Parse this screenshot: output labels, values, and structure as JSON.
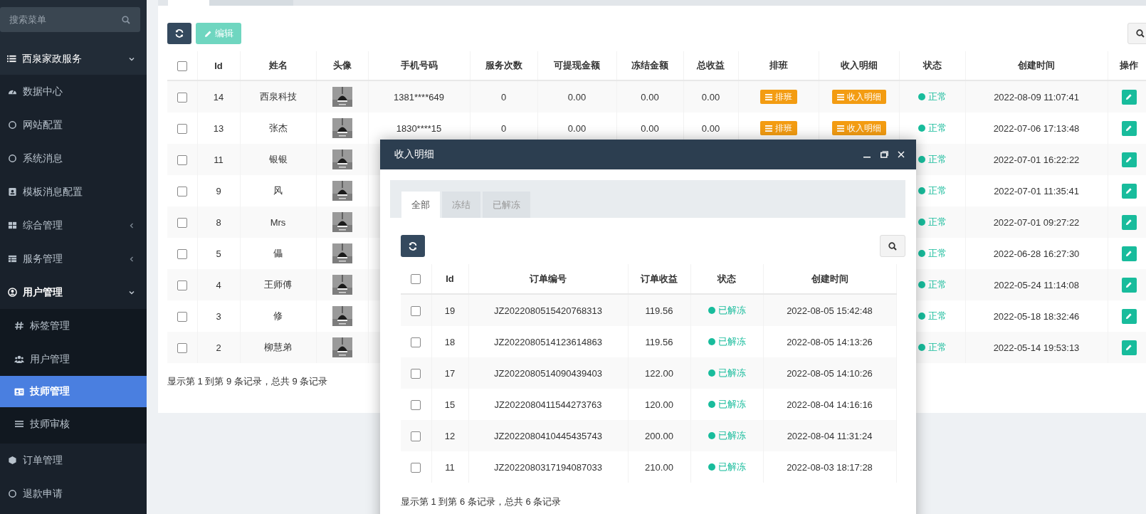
{
  "sidebar": {
    "search": {
      "placeholder": "搜索菜单"
    },
    "items": [
      {
        "label": "西泉家政服务",
        "kind": "group",
        "expanded": true
      },
      {
        "label": "数据中心",
        "kind": "item",
        "selected": false
      },
      {
        "label": "网站配置",
        "kind": "item",
        "selected": false
      },
      {
        "label": "系统消息",
        "kind": "item",
        "selected": false
      },
      {
        "label": "模板消息配置",
        "kind": "item",
        "selected": false
      },
      {
        "label": "综合管理",
        "kind": "item",
        "selected": false,
        "expanded": false
      },
      {
        "label": "服务管理",
        "kind": "item",
        "selected": false,
        "expanded": false
      },
      {
        "label": "用户管理",
        "kind": "item",
        "selected": false,
        "expanded": true,
        "children": [
          {
            "label": "标签管理",
            "selected": false
          },
          {
            "label": "用户管理",
            "selected": false
          },
          {
            "label": "技师管理",
            "selected": true
          },
          {
            "label": "技师审核",
            "selected": false
          }
        ]
      },
      {
        "label": "订单管理",
        "kind": "item",
        "selected": false
      },
      {
        "label": "退款申请",
        "kind": "item",
        "selected": false
      }
    ]
  },
  "toolbar": {
    "edit_label": "编辑"
  },
  "table": {
    "header_checked": false,
    "columns": [
      "Id",
      "姓名",
      "头像",
      "手机号码",
      "服务次数",
      "可提现金额",
      "冻结金额",
      "总收益",
      "排班",
      "收入明细",
      "状态",
      "创建时间",
      "操作"
    ],
    "rows": [
      {
        "checked": false,
        "id": "14",
        "name": "西泉科技",
        "phone": "1381****649",
        "service_count": "0",
        "withdrawable": "0.00",
        "frozen": "0.00",
        "total": "0.00",
        "schedule": "排班",
        "income": "收入明细",
        "status": "正常",
        "created": "2022-08-09 11:07:41"
      },
      {
        "checked": false,
        "id": "13",
        "name": "张杰",
        "phone": "1830****15",
        "service_count": "0",
        "withdrawable": "0.00",
        "frozen": "0.00",
        "total": "0.00",
        "schedule": "排班",
        "income": "收入明细",
        "status": "正常",
        "created": "2022-07-06 17:13:48"
      },
      {
        "checked": false,
        "id": "11",
        "name": "银银",
        "status": "正常",
        "created": "2022-07-01 16:22:22"
      },
      {
        "checked": false,
        "id": "9",
        "name": "风",
        "status": "正常",
        "created": "2022-07-01 11:35:41"
      },
      {
        "checked": false,
        "id": "8",
        "name": "Mrs",
        "status": "正常",
        "created": "2022-07-01 09:27:22"
      },
      {
        "checked": false,
        "id": "5",
        "name": "儡",
        "status": "正常",
        "created": "2022-06-28 16:27:30"
      },
      {
        "checked": false,
        "id": "4",
        "name": "王师傅",
        "status": "正常",
        "created": "2022-05-24 11:14:08"
      },
      {
        "checked": false,
        "id": "3",
        "name": "修",
        "status": "正常",
        "created": "2022-05-18 18:32:46"
      },
      {
        "checked": false,
        "id": "2",
        "name": "柳慧弟",
        "status": "正常",
        "created": "2022-05-14 19:53:13"
      }
    ],
    "footer": "显示第 1 到第 9 条记录，总共 9 条记录"
  },
  "modal": {
    "title": "收入明细",
    "tabs": [
      {
        "label": "全部",
        "selected": true
      },
      {
        "label": "冻结",
        "selected": false
      },
      {
        "label": "已解冻",
        "selected": false
      }
    ],
    "table": {
      "header_checked": false,
      "columns": [
        "Id",
        "订单编号",
        "订单收益",
        "状态",
        "创建时间"
      ],
      "rows": [
        {
          "checked": false,
          "id": "19",
          "order_no": "JZ2022080515420768313",
          "income": "119.56",
          "status": "已解冻",
          "created": "2022-08-05 15:42:48"
        },
        {
          "checked": false,
          "id": "18",
          "order_no": "JZ2022080514123614863",
          "income": "119.56",
          "status": "已解冻",
          "created": "2022-08-05 14:13:26"
        },
        {
          "checked": false,
          "id": "17",
          "order_no": "JZ2022080514090439403",
          "income": "122.00",
          "status": "已解冻",
          "created": "2022-08-05 14:10:26"
        },
        {
          "checked": false,
          "id": "15",
          "order_no": "JZ2022080411544273763",
          "income": "120.00",
          "status": "已解冻",
          "created": "2022-08-04 14:16:16"
        },
        {
          "checked": false,
          "id": "12",
          "order_no": "JZ2022080410445435743",
          "income": "200.00",
          "status": "已解冻",
          "created": "2022-08-04 11:31:24"
        },
        {
          "checked": false,
          "id": "11",
          "order_no": "JZ2022080317194087033",
          "income": "210.00",
          "status": "已解冻",
          "created": "2022-08-03 18:17:28"
        }
      ],
      "footer": "显示第 1 到第 6 条记录，总共 6 条记录"
    }
  }
}
